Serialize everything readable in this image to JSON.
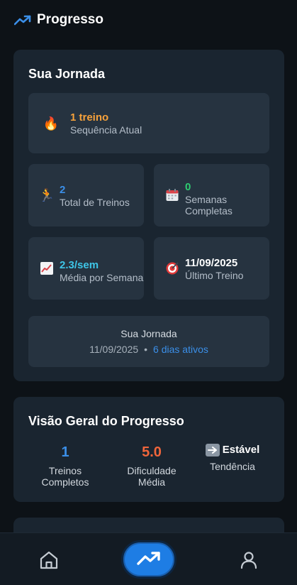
{
  "header": {
    "title": "Progresso",
    "icon": "trending-up-icon"
  },
  "journey": {
    "title": "Sua Jornada",
    "streak": {
      "icon": "fire-icon",
      "value": "1 treino",
      "label": "Sequência Atual",
      "color": "#f7a23b"
    },
    "stats": [
      {
        "icon": "runner-icon",
        "value": "2",
        "label": "Total de Treinos",
        "color": "#3b8fe8"
      },
      {
        "icon": "calendar-icon",
        "value": "0",
        "label": "Semanas Completas",
        "color": "#2ecc71"
      },
      {
        "icon": "chart-increasing-icon",
        "value": "2.3/sem",
        "label": "Média por Semana",
        "color": "#3ec6e8"
      },
      {
        "icon": "target-icon",
        "value": "11/09/2025",
        "label": "Último Treino",
        "color": "#ffffff"
      }
    ],
    "footer": {
      "title": "Sua Jornada",
      "date": "11/09/2025",
      "separator": "•",
      "active": "6 dias ativos"
    }
  },
  "overview": {
    "title": "Visão Geral do Progresso",
    "items": [
      {
        "value": "1",
        "label": "Treinos Completos",
        "color": "#3b8fe8"
      },
      {
        "value": "5.0",
        "label": "Dificuldade Média",
        "color": "#f0653b"
      },
      {
        "icon": "right-arrow-icon",
        "value": "Estável",
        "label": "Tendência",
        "color": "#ffffff"
      }
    ]
  },
  "nav": {
    "items": [
      {
        "name": "home",
        "icon": "home-icon"
      },
      {
        "name": "progress",
        "icon": "trending-up-icon",
        "active": true
      },
      {
        "name": "profile",
        "icon": "user-icon"
      }
    ]
  }
}
